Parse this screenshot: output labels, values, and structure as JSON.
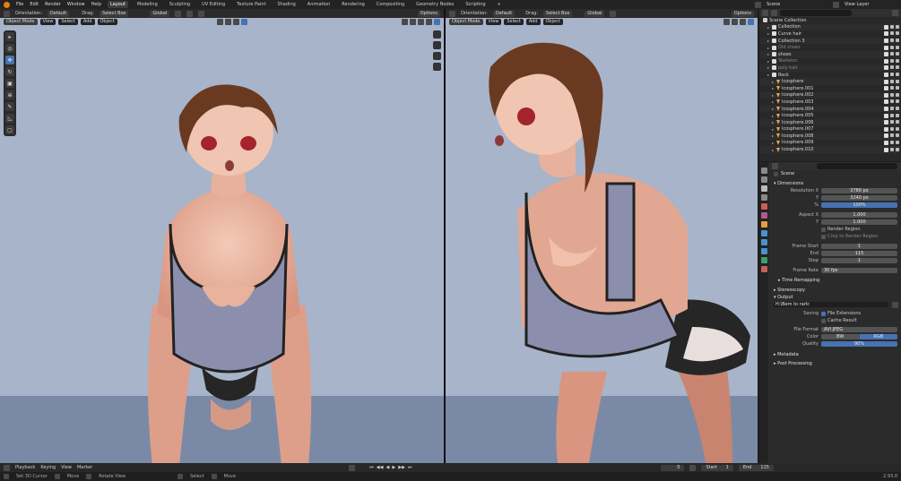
{
  "topbar": {
    "menus": [
      "File",
      "Edit",
      "Render",
      "Window",
      "Help"
    ],
    "workspaces": [
      "Layout",
      "Modeling",
      "Sculpting",
      "UV Editing",
      "Texture Paint",
      "Shading",
      "Animation",
      "Rendering",
      "Compositing",
      "Geometry Nodes",
      "Scripting"
    ],
    "active_workspace": "Layout",
    "add_tab": "+",
    "scene": "Scene",
    "view_layer": "View Layer"
  },
  "viewport_left": {
    "orientation_label": "Orientation:",
    "orientation_value": "Default",
    "drag_label": "Drag:",
    "drag_value": "Select Box",
    "transform_value": "Global",
    "options": "Options",
    "mode": "Object Mode",
    "menus": [
      "View",
      "Select",
      "Add",
      "Object"
    ]
  },
  "viewport_right": {
    "orientation_label": "Orientation:",
    "orientation_value": "Default",
    "drag_label": "Drag:",
    "drag_value": "Select Box",
    "transform_value": "Global",
    "options": "Options",
    "mode": "Object Mode",
    "menus": [
      "View",
      "Select",
      "Add",
      "Object"
    ]
  },
  "outliner": {
    "title": "Scene Collection",
    "rows": [
      {
        "label": "Collection",
        "indent": 1,
        "icon": "collection-icon",
        "dim": false
      },
      {
        "label": "Curve hair",
        "indent": 1,
        "icon": "collection-icon",
        "dim": false
      },
      {
        "label": "Collection 3",
        "indent": 1,
        "icon": "collection-icon",
        "dim": false
      },
      {
        "label": "Old shoes",
        "indent": 1,
        "icon": "collection-icon",
        "dim": true
      },
      {
        "label": "shoes",
        "indent": 1,
        "icon": "collection-icon",
        "dim": false
      },
      {
        "label": "Skeleton",
        "indent": 1,
        "icon": "collection-icon",
        "dim": true
      },
      {
        "label": "poly hair",
        "indent": 1,
        "icon": "collection-icon",
        "dim": true
      },
      {
        "label": "Rock",
        "indent": 1,
        "icon": "collection-icon",
        "dim": false
      },
      {
        "label": "Icosphere",
        "indent": 2,
        "icon": "mesh-icon",
        "dim": false
      },
      {
        "label": "Icosphere.001",
        "indent": 2,
        "icon": "mesh-icon",
        "dim": false
      },
      {
        "label": "Icosphere.002",
        "indent": 2,
        "icon": "mesh-icon",
        "dim": false
      },
      {
        "label": "Icosphere.003",
        "indent": 2,
        "icon": "mesh-icon",
        "dim": false
      },
      {
        "label": "Icosphere.004",
        "indent": 2,
        "icon": "mesh-icon",
        "dim": false
      },
      {
        "label": "Icosphere.005",
        "indent": 2,
        "icon": "mesh-icon",
        "dim": false
      },
      {
        "label": "Icosphere.006",
        "indent": 2,
        "icon": "mesh-icon",
        "dim": false
      },
      {
        "label": "Icosphere.007",
        "indent": 2,
        "icon": "mesh-icon",
        "dim": false
      },
      {
        "label": "Icosphere.008",
        "indent": 2,
        "icon": "mesh-icon",
        "dim": false
      },
      {
        "label": "Icosphere.009",
        "indent": 2,
        "icon": "mesh-icon",
        "dim": false
      },
      {
        "label": "Icosphere.010",
        "indent": 2,
        "icon": "mesh-icon",
        "dim": false
      }
    ]
  },
  "properties": {
    "context": "Scene",
    "dimensions": "Dimensions",
    "res_x_label": "Resolution X",
    "res_x": "3780 px",
    "res_y_label": "Y",
    "res_y": "3240 px",
    "percent_label": "%",
    "percent": "100%",
    "aspect_x_label": "Aspect X",
    "aspect_x": "1.000",
    "aspect_y_label": "Y",
    "aspect_y": "1.000",
    "render_region": "Render Region",
    "crop_region": "Crop to Render Region",
    "frame_start_label": "Frame Start",
    "frame_start": "1",
    "end_label": "End",
    "end": "115",
    "step_label": "Step",
    "step": "1",
    "frame_rate_label": "Frame Rate",
    "frame_rate": "30 fps",
    "time_remapping": "Time Remapping",
    "stereoscopy": "Stereoscopy",
    "output": "Output",
    "output_path": "H:\\Bem to rarlc",
    "saving_label": "Saving",
    "file_extensions": "File Extensions",
    "cache_result": "Cache Result",
    "file_format_label": "File Format",
    "file_format": "AVI JPEG",
    "color_label": "Color",
    "color_bw": "BW",
    "color_rgb": "RGB",
    "quality_label": "Quality",
    "quality": "90%",
    "metadata": "Metadata",
    "post_processing": "Post Processing"
  },
  "timeline": {
    "menus": [
      "Playback",
      "Keying",
      "View",
      "Marker"
    ],
    "current_frame": "0",
    "start_label": "Start",
    "start": "1",
    "end_label": "End",
    "end": "115"
  },
  "statusbar": {
    "items": [
      "Set 3D Cursor",
      "Move",
      "Rotate View",
      "Select",
      "Move"
    ],
    "version": "2.93.0"
  },
  "colors": {
    "accent": "#4772b3",
    "viewport_bg": "#a7b4ca",
    "blender_orange": "#e87d0d"
  }
}
